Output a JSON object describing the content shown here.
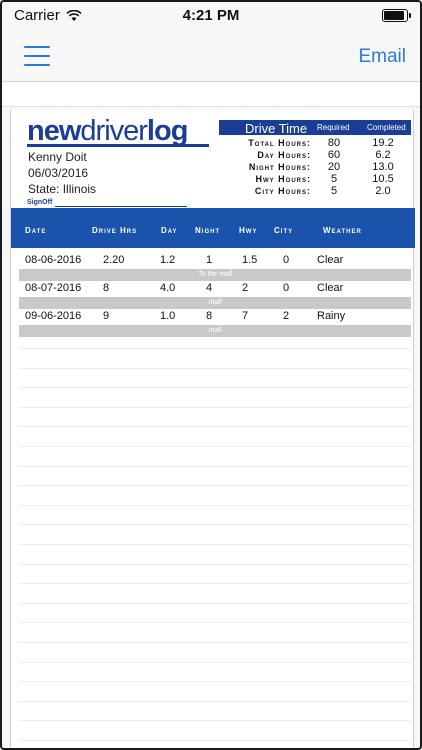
{
  "status_bar": {
    "carrier": "Carrier",
    "time": "4:21 PM",
    "battery_level": 1.0
  },
  "navbar": {
    "menu_icon": "hamburger-menu-icon",
    "email_label": "Email"
  },
  "logo": {
    "part1": "new",
    "part2": "driver",
    "part3": "log"
  },
  "driver": {
    "name": "Kenny Doit",
    "date": "06/03/2016",
    "state": "State:  Illinois",
    "signoff_label": "SignOff"
  },
  "drive_time": {
    "title": "Drive Time",
    "required_label": "Required",
    "completed_label": "Completed",
    "rows": [
      {
        "label": "Total Hours:",
        "required": "80",
        "completed": "19.2"
      },
      {
        "label": "Day Hours:",
        "required": "60",
        "completed": "6.2"
      },
      {
        "label": "Night Hours:",
        "required": "20",
        "completed": "13.0"
      },
      {
        "label": "Hwy Hours:",
        "required": "5",
        "completed": "10.5"
      },
      {
        "label": "City Hours:",
        "required": "5",
        "completed": "2.0"
      }
    ]
  },
  "table": {
    "columns": [
      "Date",
      "Drive Hrs",
      "Day",
      "Night",
      "Hwy",
      "City",
      "Weather"
    ],
    "rows": [
      {
        "date": "08-06-2016",
        "drive_hrs": "2.20",
        "day": "1.2",
        "night": "1",
        "hwy": "1.5",
        "city": "0",
        "weather": "Clear",
        "comment": "To the mall"
      },
      {
        "date": "08-07-2016",
        "drive_hrs": "8",
        "day": "4.0",
        "night": "4",
        "hwy": "2",
        "city": "0",
        "weather": "Clear",
        "comment": "mall"
      },
      {
        "date": "09-06-2016",
        "drive_hrs": "9",
        "day": "1.0",
        "night": "8",
        "hwy": "7",
        "city": "2",
        "weather": "Rainy",
        "comment": "mall"
      }
    ]
  },
  "colors": {
    "accent": "#2a7ae2",
    "brand": "#1a3e96",
    "table_header": "#1a52ac",
    "comment_bg": "#c9c9c9"
  }
}
